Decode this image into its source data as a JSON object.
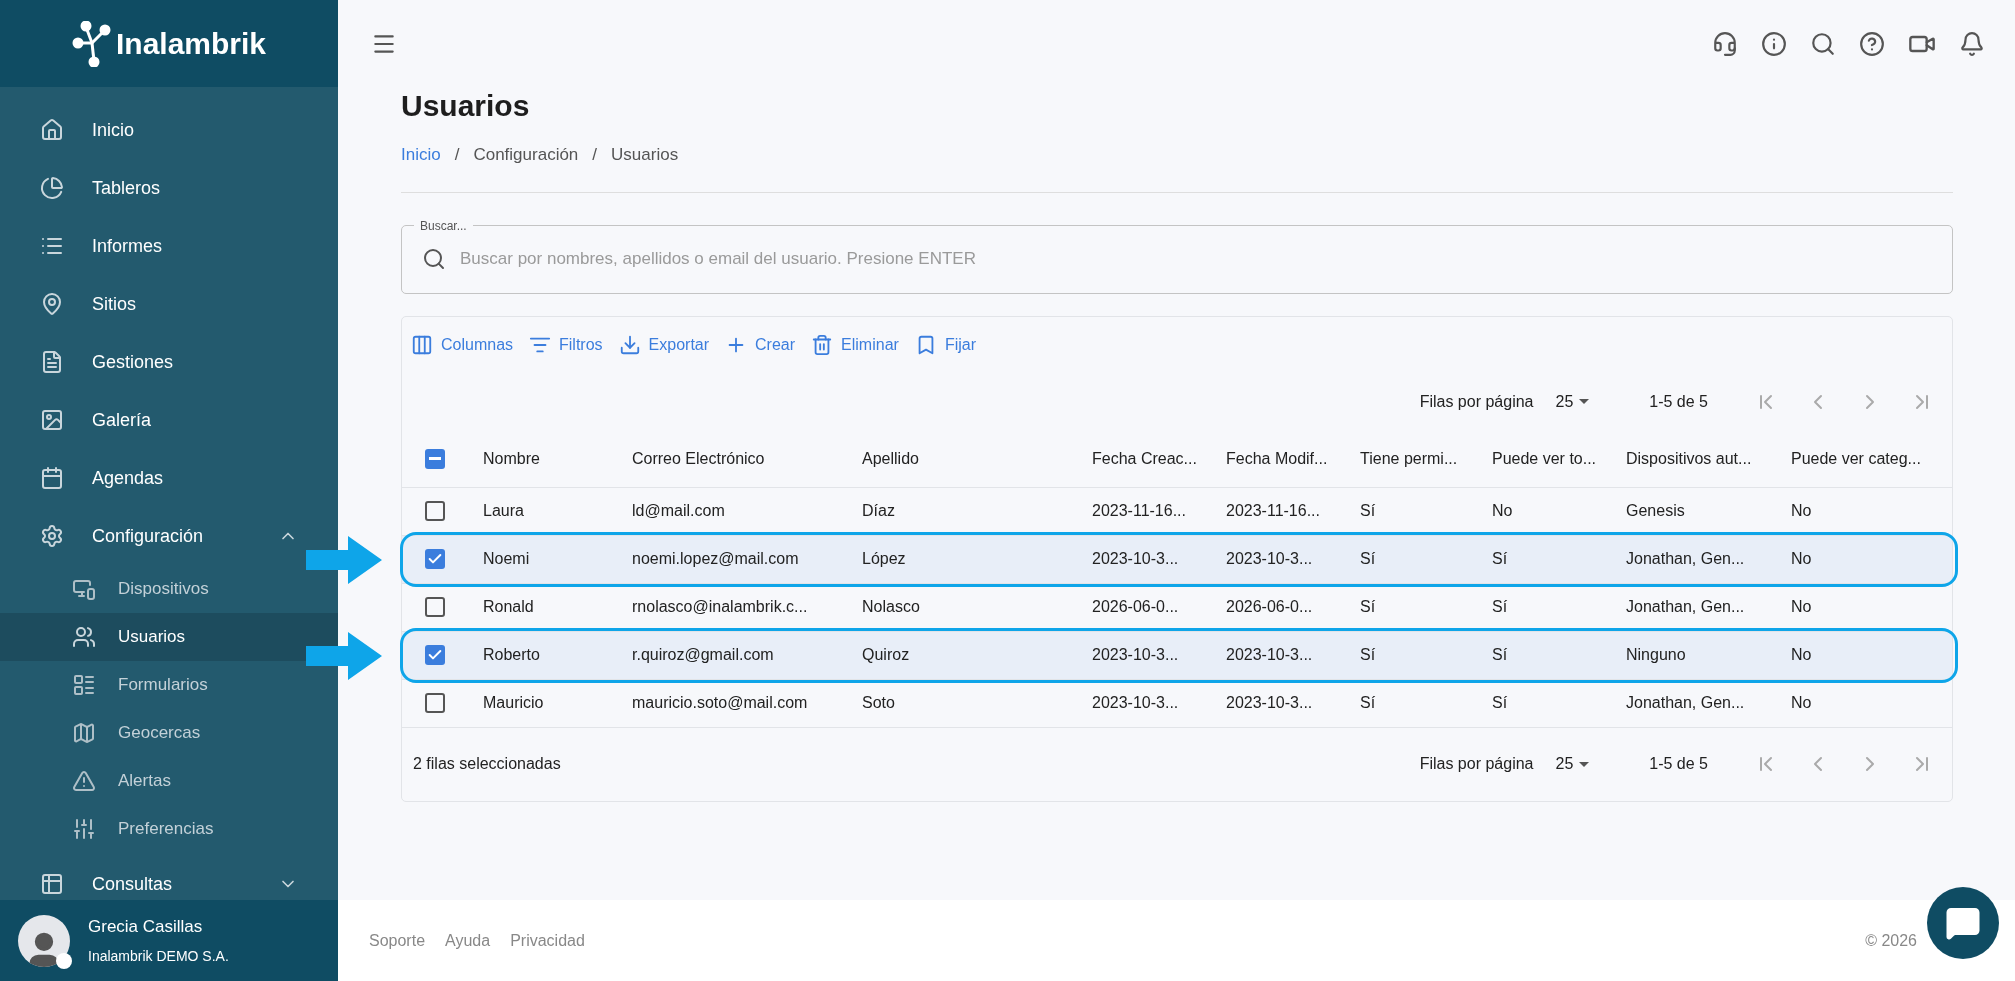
{
  "logo": {
    "text": "Inalambrik"
  },
  "sidebar": {
    "items": [
      {
        "label": "Inicio"
      },
      {
        "label": "Tableros"
      },
      {
        "label": "Informes"
      },
      {
        "label": "Sitios"
      },
      {
        "label": "Gestiones"
      },
      {
        "label": "Galería"
      },
      {
        "label": "Agendas"
      },
      {
        "label": "Configuración",
        "expanded": true,
        "children": [
          {
            "label": "Dispositivos",
            "selected": false
          },
          {
            "label": "Usuarios",
            "selected": true
          },
          {
            "label": "Formularios",
            "selected": false
          },
          {
            "label": "Geocercas",
            "selected": false
          },
          {
            "label": "Alertas",
            "selected": false
          },
          {
            "label": "Preferencias",
            "selected": false
          }
        ]
      },
      {
        "label": "Consultas",
        "expanded": false
      }
    ]
  },
  "user": {
    "name": "Grecia Casillas",
    "company": "Inalambrik DEMO S.A.",
    "online": true
  },
  "page": {
    "title": "Usuarios",
    "breadcrumb_separator": "/",
    "breadcrumb": [
      {
        "label": "Inicio",
        "link": true
      },
      {
        "label": "Configuración",
        "link": false
      },
      {
        "label": "Usuarios",
        "link": false
      }
    ]
  },
  "search": {
    "label": "Buscar...",
    "placeholder": "Buscar por nombres, apellidos o email del usuario. Presione ENTER"
  },
  "toolbar": [
    "Columnas",
    "Filtros",
    "Exportar",
    "Crear",
    "Eliminar",
    "Fijar"
  ],
  "pagination_top": {
    "label": "Filas por página",
    "page_size": "25",
    "range": "1-5 de 5"
  },
  "table": {
    "header_indeterminate": true,
    "columns": [
      "Nombre",
      "Correo Electrónico",
      "Apellido",
      "Fecha Creac...",
      "Fecha Modif...",
      "Tiene permi...",
      "Puede ver to...",
      "Dispositivos aut...",
      "Puede ver categ..."
    ],
    "rows": [
      {
        "selected": false,
        "callout": false,
        "cells": [
          "Laura",
          "ld@mail.com",
          "Díaz",
          "2023-11-16...",
          "2023-11-16...",
          "Sí",
          "No",
          "Genesis",
          "No"
        ]
      },
      {
        "selected": true,
        "callout": true,
        "cells": [
          "Noemi",
          "noemi.lopez@mail.com",
          "López",
          "2023-10-3...",
          "2023-10-3...",
          "Sí",
          "Sí",
          "Jonathan, Gen...",
          "No"
        ]
      },
      {
        "selected": false,
        "callout": false,
        "cells": [
          "Ronald",
          "rnolasco@inalambrik.c...",
          "Nolasco",
          "2026-06-0...",
          "2026-06-0...",
          "Sí",
          "Sí",
          "Jonathan, Gen...",
          "No"
        ]
      },
      {
        "selected": true,
        "callout": true,
        "cells": [
          "Roberto",
          "r.quiroz@gmail.com",
          "Quiroz",
          "2023-10-3...",
          "2023-10-3...",
          "Sí",
          "Sí",
          "Ninguno",
          "No"
        ]
      },
      {
        "selected": false,
        "callout": false,
        "cells": [
          "Mauricio",
          "mauricio.soto@mail.com",
          "Soto",
          "2023-10-3...",
          "2023-10-3...",
          "Sí",
          "Sí",
          "Jonathan, Gen...",
          "No"
        ]
      }
    ],
    "selection_text": "2 filas seleccionadas"
  },
  "pagination_bottom": {
    "label": "Filas por página",
    "page_size": "25",
    "range": "1-5 de 5"
  },
  "footer": {
    "links": [
      "Soporte",
      "Ayuda",
      "Privacidad"
    ],
    "copyright": "© 2026"
  }
}
